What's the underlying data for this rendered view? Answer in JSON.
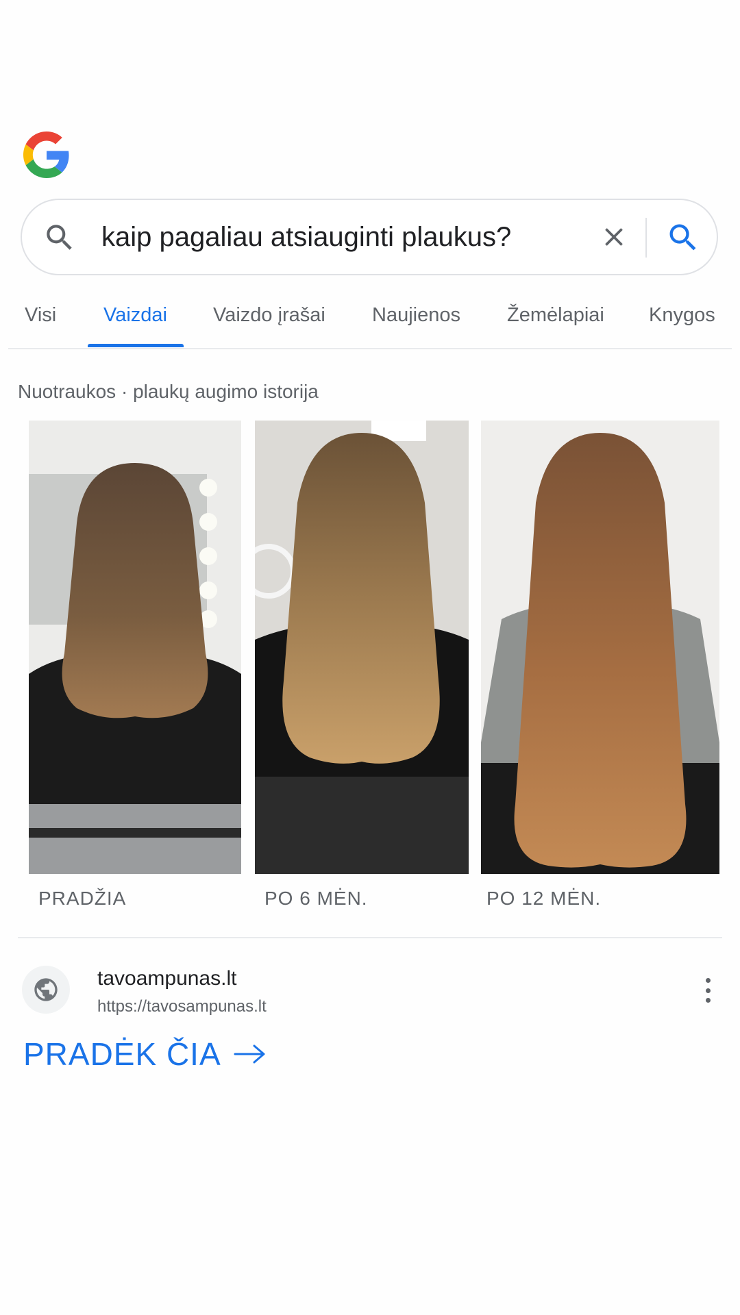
{
  "search": {
    "query": "kaip pagaliau atsiauginti plaukus?"
  },
  "tabs": [
    {
      "label": "Visi",
      "active": false
    },
    {
      "label": "Vaizdai",
      "active": true
    },
    {
      "label": "Vaizdo įrašai",
      "active": false
    },
    {
      "label": "Naujienos",
      "active": false
    },
    {
      "label": "Žemėlapiai",
      "active": false
    },
    {
      "label": "Knygos",
      "active": false
    }
  ],
  "images_section": {
    "caption": "Nuotraukos · plaukų augimo istorija",
    "items": [
      {
        "label": "PRADŽIA",
        "hair_length": 0.62
      },
      {
        "label": "PO 6 MĖN.",
        "hair_length": 0.75
      },
      {
        "label": "PO 12 MĖN.",
        "hair_length": 0.97
      }
    ]
  },
  "result": {
    "site_name": "tavoampunas.lt",
    "url": "https://tavosampunas.lt",
    "cta": "PRADĖK ČIA"
  },
  "colors": {
    "accent": "#1a73e8",
    "text_primary": "#202124",
    "text_secondary": "#5f6368",
    "divider": "#e8eaed"
  },
  "icons": {
    "logo": "google-g-logo",
    "search_left": "search-icon",
    "clear": "close-icon",
    "search_submit": "search-icon",
    "site": "globe-icon",
    "more": "more-vertical-icon",
    "cta_arrow": "arrow-right-icon"
  }
}
